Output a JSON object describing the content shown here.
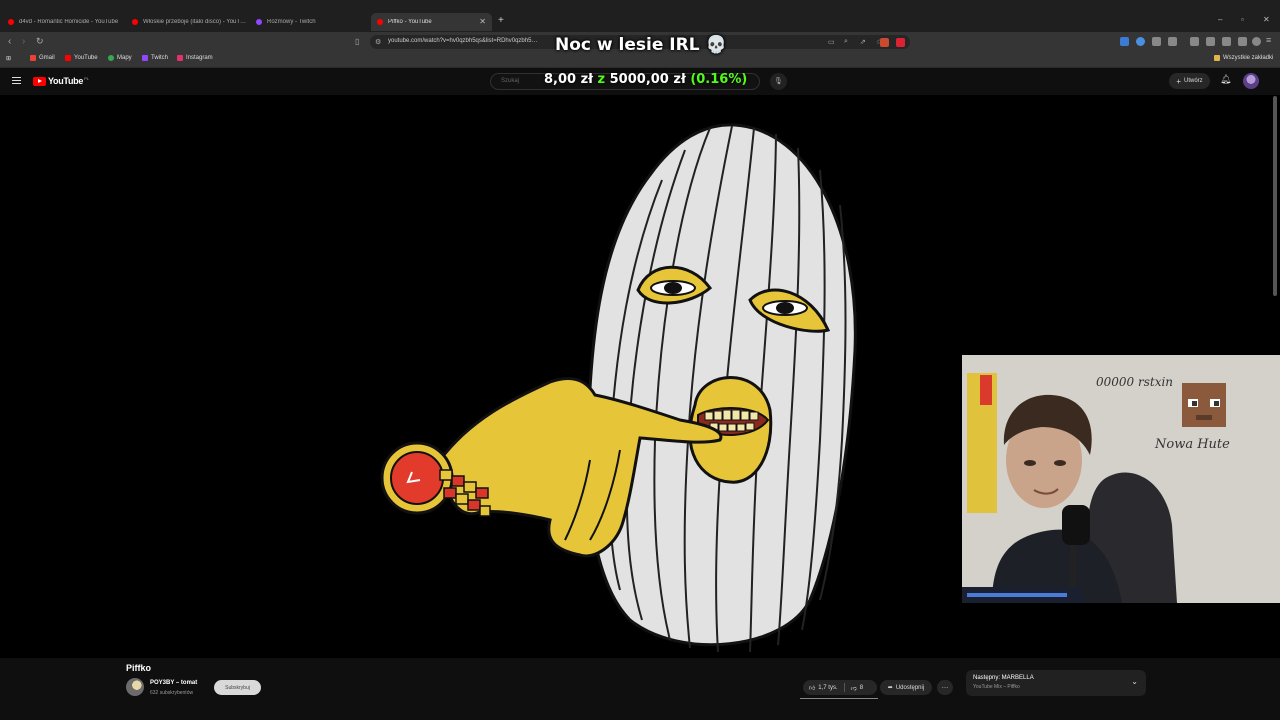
{
  "tabs": [
    {
      "label": "d4vd - Romantic Homicide - YouTube",
      "favicon_color": "#ff0000",
      "active": false
    },
    {
      "label": "Włoskie przeboje (italo disco) - YouT…",
      "favicon_color": "#ff0000",
      "active": false
    },
    {
      "label": "Rozmowy - Twitch",
      "favicon_color": "#9146ff",
      "active": false
    },
    {
      "label": "Piffko - YouTube",
      "favicon_color": "#ff0000",
      "active": true
    }
  ],
  "window_controls": {
    "minimize": "–",
    "maximize": "▫",
    "close": "✕"
  },
  "address": {
    "url": "youtube.com/watch?v=hv0qzbh5qs&list=RDhv0qzbh5…",
    "icons": {
      "back": "back-arrow-icon",
      "forward": "forward-arrow-icon",
      "reload": "reload-icon",
      "bookmark": "bookmark-icon"
    }
  },
  "bookmarks": [
    {
      "label": "Gmail",
      "color": "#ea4335"
    },
    {
      "label": "YouTube",
      "color": "#ff0000"
    },
    {
      "label": "Mapy",
      "color": "#34a853"
    },
    {
      "label": "Twitch",
      "color": "#9146ff"
    },
    {
      "label": "Instagram",
      "color": "#e1306c"
    }
  ],
  "bookmarks_all": "Wszystkie zakładki",
  "youtube": {
    "logo": "YouTube",
    "logo_suffix": "PL",
    "search_placeholder": "Szukaj",
    "create_label": "Utwórz"
  },
  "overlay": {
    "title": "Noc w lesie IRL",
    "title_emoji": "💀",
    "goal_current": "8,00 zł",
    "goal_word": "z",
    "goal_target": "5000,00 zł",
    "goal_percent": "(0.16%)",
    "goal_fraction": 0.0016
  },
  "webcam": {
    "wall_text_1": "00000 rstxin",
    "wall_text_2": "Nowa Hute"
  },
  "video": {
    "title": "Piffko",
    "channel": "POY3BY – tomat",
    "subscribers": "632 subskrybentów",
    "subscribe_label": "Subskrybuj",
    "likes": "1,7 tys.",
    "dislikes": "8",
    "share_label": "Udostępnij",
    "more_label": "…"
  },
  "mix": {
    "next_label": "Następny: MARBELLA",
    "subtitle": "YouTube Mix – Piffko"
  },
  "colors": {
    "accent_red": "#ff0000",
    "goal_green": "#53fc18",
    "mask_yellow": "#e6c539"
  }
}
